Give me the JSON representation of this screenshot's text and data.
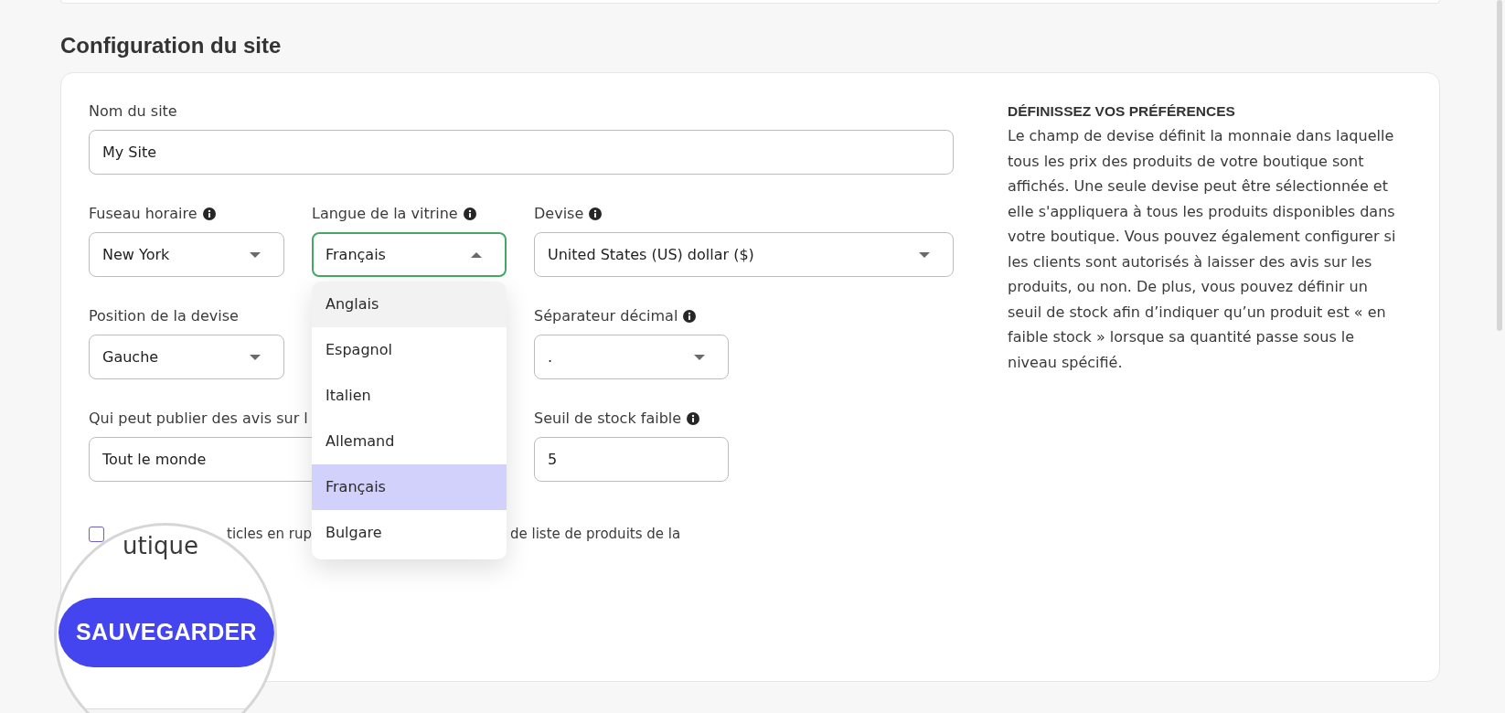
{
  "section_title": "Configuration du site",
  "form": {
    "rows": [
      [
        {
          "kind": "input",
          "label": "Nom du site",
          "info": false,
          "value": "My Site"
        }
      ],
      [
        {
          "kind": "select",
          "label": "Fuseau horaire",
          "info": true,
          "value": "New York",
          "expanded": false
        },
        {
          "kind": "select",
          "label": "Langue de la vitrine",
          "info": true,
          "value": "Français",
          "expanded": true,
          "options": [
            {
              "label": "Anglais",
              "selected": false,
              "hovered": true
            },
            {
              "label": "Espagnol",
              "selected": false,
              "hovered": false
            },
            {
              "label": "Italien",
              "selected": false,
              "hovered": false
            },
            {
              "label": "Allemand",
              "selected": false,
              "hovered": false
            },
            {
              "label": "Français",
              "selected": true,
              "hovered": false
            },
            {
              "label": "Bulgare",
              "selected": false,
              "hovered": false
            }
          ]
        },
        {
          "kind": "select",
          "label": "Devise",
          "info": true,
          "value": "United States (US) dollar ($)",
          "expanded": false
        }
      ],
      [
        {
          "kind": "select",
          "label": "Position de la devise",
          "info": false,
          "value": "Gauche",
          "expanded": false
        },
        {
          "kind": "select",
          "label": "Séparateur décimal",
          "info": true,
          "value": ".",
          "expanded": false
        }
      ],
      [
        {
          "kind": "input",
          "label": "Qui peut publier des avis sur l",
          "info": false,
          "value": "Tout le monde"
        },
        {
          "kind": "input",
          "label": "Seuil de stock faible",
          "info": true,
          "value": "5"
        }
      ]
    ],
    "checkbox": {
      "checked": false,
      "label_fragments": [
        "ticles en rup",
        "de liste de produits de la"
      ]
    }
  },
  "magnifier": {
    "text": "utique",
    "button": "SAUVEGARDER"
  },
  "help": {
    "heading": "DÉFINISSEZ VOS PRÉFÉRENCES",
    "text": "Le champ de devise définit la monnaie dans laquelle tous les prix des produits de votre boutique sont affichés. Une seule devise peut être sélectionnée et elle s'appliquera à tous les produits disponibles dans votre boutique. Vous pouvez également configurer si les clients sont autorisés à laisser des avis sur les produits, ou non. De plus, vous pouvez définir un seuil de stock afin d’indiquer qu’un produit est « en faible stock » lorsque sa quantité passe sous le niveau spécifié."
  }
}
